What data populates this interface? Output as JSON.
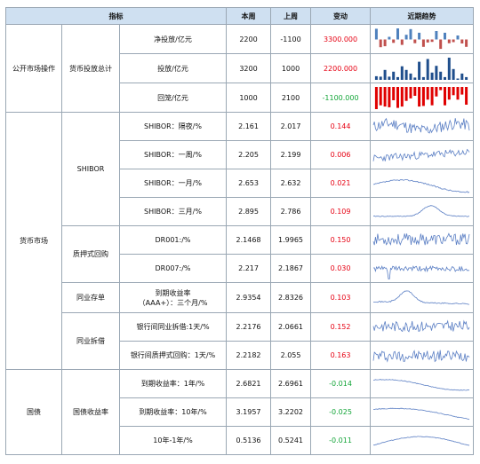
{
  "header": {
    "indicator": "指标",
    "this_week": "本周",
    "last_week": "上周",
    "change": "变动",
    "trend": "近期趋势"
  },
  "groups": {
    "omo": "公开市场操作",
    "omo_sub": "货币投放总计",
    "money_market": "货币市场",
    "shibor": "SHIBOR",
    "repo": "质押式回购",
    "ncd": "同业存单",
    "interbank": "同业拆借",
    "bonds": "国债",
    "bond_yield": "国债收益率"
  },
  "rows": [
    {
      "name": "净投放/亿元",
      "this": "2200",
      "last": "-1100",
      "change": "3300.000",
      "dir": "up"
    },
    {
      "name": "投放/亿元",
      "this": "3200",
      "last": "1000",
      "change": "2200.000",
      "dir": "up"
    },
    {
      "name": "回笼/亿元",
      "this": "1000",
      "last": "2100",
      "change": "-1100.000",
      "dir": "down"
    },
    {
      "name": "SHIBOR：隔夜/%",
      "this": "2.161",
      "last": "2.017",
      "change": "0.144",
      "dir": "up"
    },
    {
      "name": "SHIBOR：一周/%",
      "this": "2.205",
      "last": "2.199",
      "change": "0.006",
      "dir": "up"
    },
    {
      "name": "SHIBOR：一月/%",
      "this": "2.653",
      "last": "2.632",
      "change": "0.021",
      "dir": "up"
    },
    {
      "name": "SHIBOR：三月/%",
      "this": "2.895",
      "last": "2.786",
      "change": "0.109",
      "dir": "up"
    },
    {
      "name": "DR001:/%",
      "this": "2.1468",
      "last": "1.9965",
      "change": "0.150",
      "dir": "up"
    },
    {
      "name": "DR007:/%",
      "this": "2.217",
      "last": "2.1867",
      "change": "0.030",
      "dir": "up"
    },
    {
      "name": "到期收益率",
      "name2": "（AAA+）：三个月/%",
      "this": "2.9354",
      "last": "2.8326",
      "change": "0.103",
      "dir": "up"
    },
    {
      "name": "银行间同业拆借:1天/%",
      "this": "2.2176",
      "last": "2.0661",
      "change": "0.152",
      "dir": "up"
    },
    {
      "name": "银行间质押式回购：1天/%",
      "this": "2.2182",
      "last": "2.055",
      "change": "0.163",
      "dir": "up"
    },
    {
      "name": "到期收益率：1年/%",
      "this": "2.6821",
      "last": "2.6961",
      "change": "-0.014",
      "dir": "down"
    },
    {
      "name": "到期收益率：10年/%",
      "this": "3.1957",
      "last": "3.2202",
      "change": "-0.025",
      "dir": "down"
    },
    {
      "name": "10年-1年/%",
      "this": "0.5136",
      "last": "0.5241",
      "change": "-0.011",
      "dir": "down"
    }
  ],
  "sparks": {
    "bars_net": [
      3.2,
      -2.3,
      -2.0,
      0.8,
      -1.0,
      3.3,
      -1.6,
      1.4,
      3.1,
      -1.1,
      2.0,
      -2.2,
      -0.9,
      -0.7,
      2.5,
      -2.8,
      2.0,
      -1.1,
      -0.8,
      1.2,
      -1.2,
      -2.2
    ],
    "bars_inj": [
      0.8,
      0.7,
      2.2,
      0.7,
      1.8,
      0.6,
      3.0,
      2.2,
      1.4,
      0.5,
      4.0,
      0.6,
      4.6,
      1.6,
      3.1,
      1.8,
      0.6,
      4.9,
      2.4,
      0.3,
      1.4,
      0.6
    ],
    "bars_wd": [
      -3.5,
      -2.9,
      -3.1,
      -3.2,
      -2.1,
      -3.3,
      -3.1,
      -2.2,
      -1.8,
      -1.4,
      -3.1,
      -3.0,
      -2.0,
      -2.9,
      -1.5,
      -0.5,
      -2.9,
      -2.0,
      -1.3,
      -2.0,
      -1.2,
      -2.8
    ],
    "colors": {
      "positive": "#4f81bd",
      "inj": "#1f4e8c",
      "negative": "#d9343b",
      "net_neg": "#c0504d",
      "wd": "#e00000",
      "line": "#5b7fc4"
    }
  }
}
